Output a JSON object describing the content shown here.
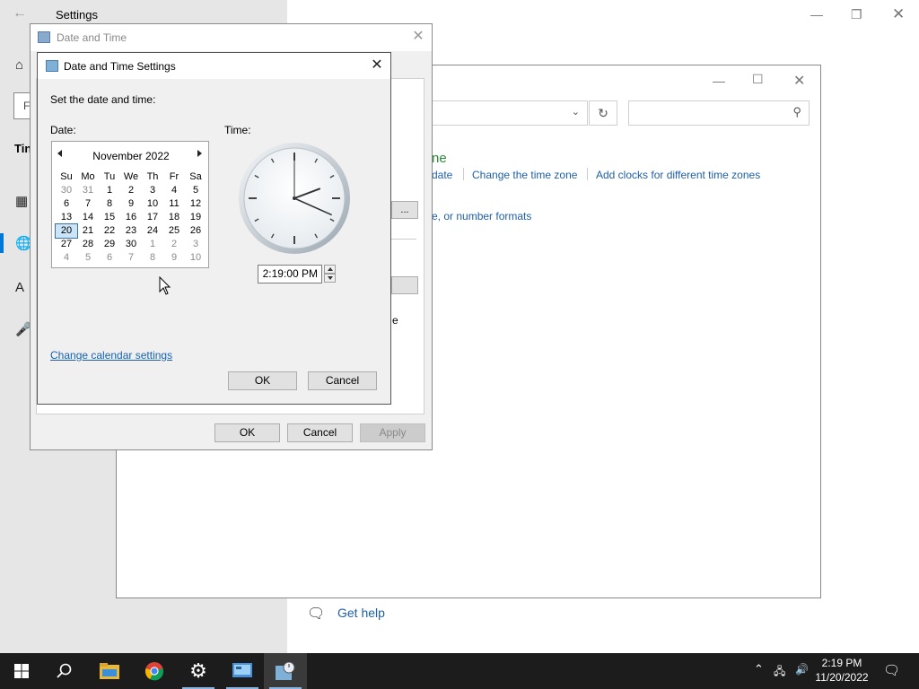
{
  "settings": {
    "title": "Settings",
    "sidebar_partial_text": "Tin",
    "search_partial": "F"
  },
  "control_panel": {
    "heading_partial": "ne",
    "link_date_partial": "date",
    "link_change_timezone": "Change the time zone",
    "link_add_clocks": "Add clocks for different time zones",
    "link_formats_partial": "e, or number formats",
    "button_partial": "...",
    "text_partial": "e"
  },
  "date_time_dialog": {
    "title": "Date and Time",
    "ok_label": "OK",
    "cancel_label": "Cancel",
    "apply_label": "Apply"
  },
  "date_time_settings": {
    "title": "Date and Time Settings",
    "instruction": "Set the date and time:",
    "date_label": "Date:",
    "time_label": "Time:",
    "time_value": "2:19:00 PM",
    "change_calendar_link": "Change calendar settings",
    "ok_label": "OK",
    "cancel_label": "Cancel",
    "calendar": {
      "month_label": "November 2022",
      "weekdays": [
        "Su",
        "Mo",
        "Tu",
        "We",
        "Th",
        "Fr",
        "Sa"
      ],
      "weeks": [
        [
          "30",
          "31",
          "1",
          "2",
          "3",
          "4",
          "5"
        ],
        [
          "6",
          "7",
          "8",
          "9",
          "10",
          "11",
          "12"
        ],
        [
          "13",
          "14",
          "15",
          "16",
          "17",
          "18",
          "19"
        ],
        [
          "20",
          "21",
          "22",
          "23",
          "24",
          "25",
          "26"
        ],
        [
          "27",
          "28",
          "29",
          "30",
          "1",
          "2",
          "3"
        ],
        [
          "4",
          "5",
          "6",
          "7",
          "8",
          "9",
          "10"
        ]
      ],
      "selected_day": "20"
    },
    "clock": {
      "hour": 2,
      "minute": 19,
      "second": 0
    }
  },
  "help": {
    "get_help": "Get help"
  },
  "taskbar": {
    "time": "2:19 PM",
    "date": "11/20/2022",
    "apps": [
      "start-icon",
      "search-icon",
      "file-explorer-icon",
      "chrome-icon",
      "settings-icon",
      "control-panel-icon",
      "date-time-icon"
    ]
  }
}
